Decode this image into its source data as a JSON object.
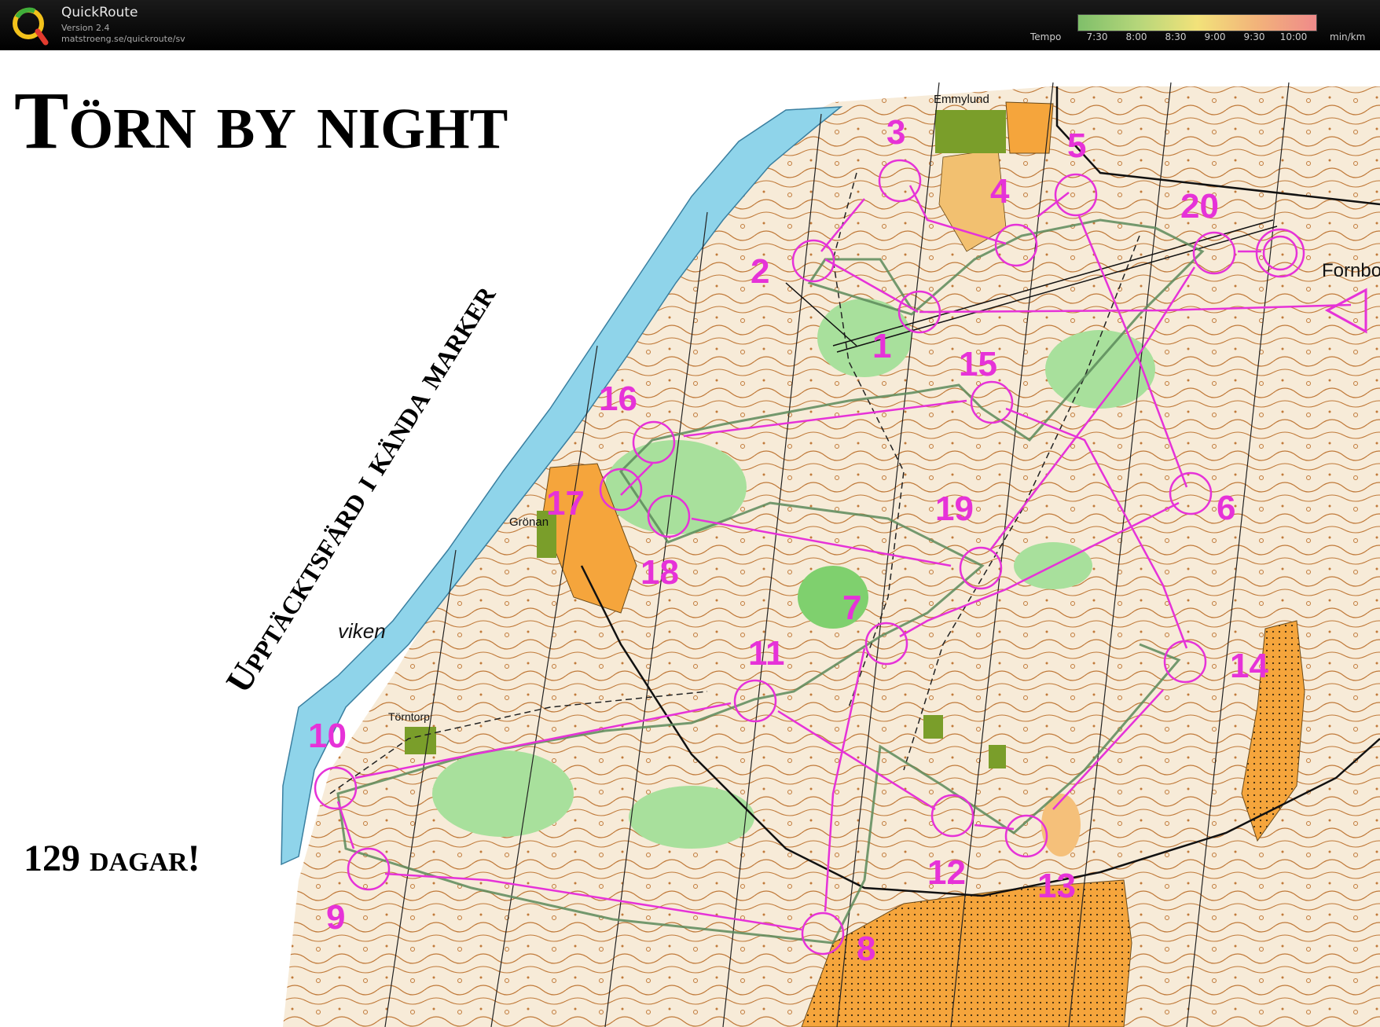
{
  "app": {
    "name": "QuickRoute",
    "version": "Version 2.4",
    "url": "matstroeng.se/quickroute/sv",
    "logo_letter": "Q"
  },
  "tempo": {
    "label": "Tempo",
    "ticks": [
      "7:30",
      "8:00",
      "8:30",
      "9:00",
      "9:30",
      "10:00"
    ],
    "unit": "min/km",
    "gradient_colors": [
      "#7fbf6a",
      "#b5d67a",
      "#f2e27a",
      "#f2b37a",
      "#ef8a8a"
    ]
  },
  "map": {
    "title": "Törn by night",
    "subtitle": "Upptäcktsfärd i kända marker",
    "countdown": "129 dagar!",
    "place_names": [
      "Emmylund",
      "Grönan",
      "Törntorp",
      "viken",
      "Fornbo"
    ],
    "controls": [
      "1",
      "2",
      "3",
      "4",
      "5",
      "6",
      "7",
      "8",
      "9",
      "10",
      "11",
      "12",
      "13",
      "14",
      "15",
      "16",
      "17",
      "18",
      "19",
      "20"
    ],
    "colors": {
      "water": "#8fd4ea",
      "open_land": "#f5a53c",
      "green": "#a8e09c",
      "terrain": "#f7ebd8",
      "contour": "#b86a2a",
      "course": "#e632d8"
    }
  }
}
